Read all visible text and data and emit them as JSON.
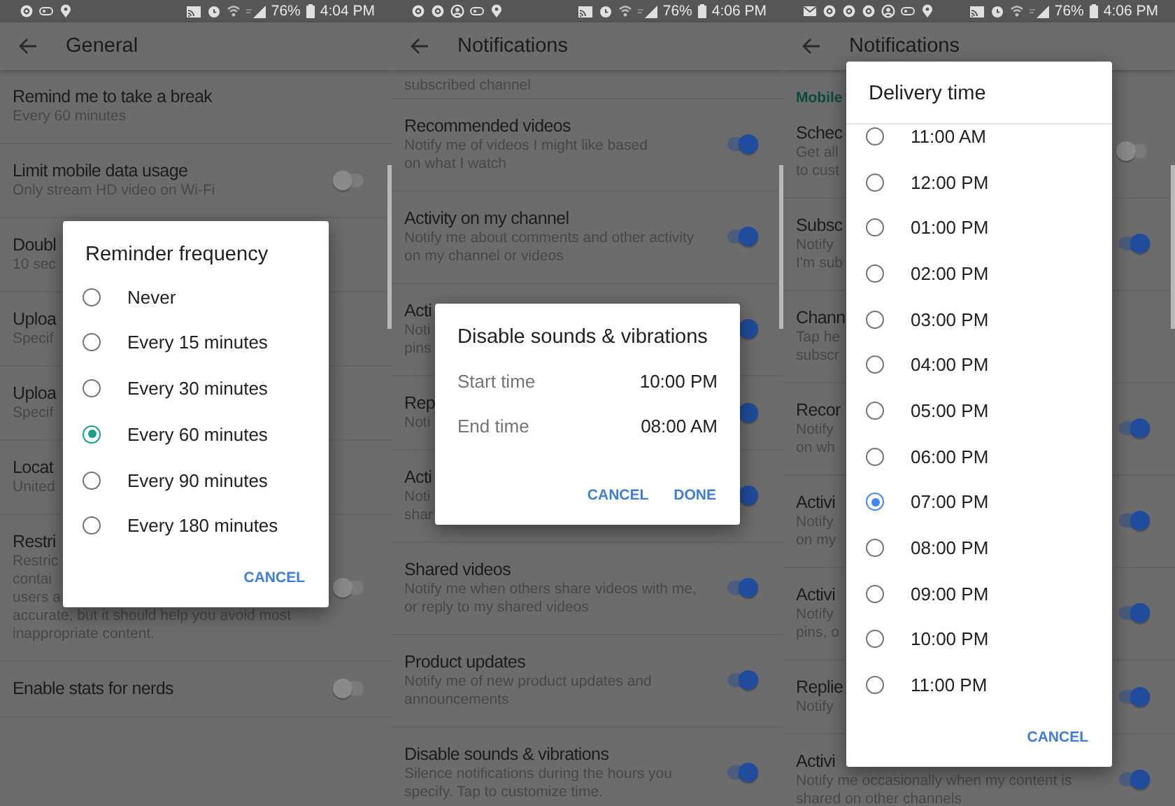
{
  "screens": [
    {
      "status_bar": {
        "icons": [
          {
            "kind": "gear"
          },
          {
            "kind": "badge"
          },
          {
            "kind": "pin"
          }
        ],
        "battery": "76%",
        "time": "4:04 PM"
      },
      "app_bar": {
        "title": "General"
      },
      "rows": [
        {
          "kind": "setting",
          "title": "Remind me to take a break",
          "description": "Every 60 minutes"
        },
        {
          "kind": "toggle",
          "title": "Limit mobile data usage",
          "description": "Only stream HD video on Wi-Fi",
          "on": false
        },
        {
          "kind": "setting",
          "title": "Doubl",
          "description": "10 sec"
        },
        {
          "kind": "setting",
          "title": "Uploa",
          "description": "Specif"
        },
        {
          "kind": "setting",
          "title": "Uploa",
          "description": "Specif"
        },
        {
          "kind": "setting",
          "title": "Locat",
          "description": "United"
        },
        {
          "kind": "toggle",
          "title": "Restri",
          "description": [
            "Restric",
            "contai",
            "users a",
            "accurate, but it should help you avoid most\ninappropriate content."
          ],
          "on": false
        },
        {
          "kind": "toggle",
          "title": "Enable stats for nerds",
          "on": false
        }
      ],
      "dialog": {
        "kind": "choices",
        "title": "Reminder frequency",
        "options": [
          {
            "label": "Never",
            "selected": false
          },
          {
            "label": "Every 15 minutes",
            "selected": false
          },
          {
            "label": "Every 30 minutes",
            "selected": false
          },
          {
            "label": "Every 60 minutes",
            "selected": true
          },
          {
            "label": "Every 90 minutes",
            "selected": false
          },
          {
            "label": "Every 180 minutes",
            "selected": false
          }
        ],
        "buttons": [
          "CANCEL"
        ]
      }
    },
    {
      "status_bar": {
        "icons": [
          {
            "kind": "gear"
          },
          {
            "kind": "gear"
          },
          {
            "kind": "person"
          },
          {
            "kind": "badge"
          },
          {
            "kind": "pin"
          }
        ],
        "battery": "76%",
        "time": "4:06 PM"
      },
      "app_bar": {
        "title": "Notifications"
      },
      "rows": [
        {
          "kind": "tail",
          "description": "subscribed channel"
        },
        {
          "kind": "toggle",
          "title": "Recommended videos",
          "description": "Notify me of videos I might like based\non what I watch",
          "on": true
        },
        {
          "kind": "toggle",
          "title": "Activity on my channel",
          "description": "Notify me about comments and other activity\non my channel or videos",
          "on": true
        },
        {
          "kind": "toggle",
          "title": "Acti",
          "description": "Noti\npins",
          "on": true
        },
        {
          "kind": "toggle",
          "title": "Rep",
          "description": "Noti",
          "on": true
        },
        {
          "kind": "toggle",
          "title": "Acti",
          "description": "Noti\nshar",
          "on": true
        },
        {
          "kind": "toggle",
          "title": "Shared videos",
          "description": "Notify me when others share videos with me,\nor reply to my shared videos",
          "on": true
        },
        {
          "kind": "toggle",
          "title": "Product updates",
          "description": "Notify me of new product updates and\nannouncements",
          "on": true
        },
        {
          "kind": "toggle",
          "title": "Disable sounds & vibrations",
          "description": "Silence notifications during the hours you\nspecify. Tap to customize time.",
          "on": true
        }
      ],
      "dialog": {
        "kind": "time_range",
        "title": "Disable sounds & vibrations",
        "rows": [
          {
            "label": "Start time",
            "value": "10:00 PM"
          },
          {
            "label": "End time",
            "value": "08:00 AM"
          }
        ],
        "buttons": [
          "CANCEL",
          "DONE"
        ]
      }
    },
    {
      "status_bar": {
        "icons": [
          {
            "kind": "mail"
          },
          {
            "kind": "gear"
          },
          {
            "kind": "gear"
          },
          {
            "kind": "gear"
          },
          {
            "kind": "person"
          },
          {
            "kind": "badge"
          },
          {
            "kind": "pin"
          }
        ],
        "battery": "76%",
        "time": "4:06 PM"
      },
      "app_bar": {
        "title": "Notifications"
      },
      "rows": [
        {
          "kind": "header",
          "title": "Mobile"
        },
        {
          "kind": "toggle",
          "title": "Schec",
          "description": "Get all\nto cust",
          "on": false
        },
        {
          "kind": "toggle",
          "title": "Subsc",
          "description": "Notify\nI'm sub",
          "on": true
        },
        {
          "kind": "setting",
          "title": "Chann",
          "description": "Tap he\nsubscr"
        },
        {
          "kind": "toggle",
          "title": "Recor",
          "description": "Notify\non wh",
          "on": true
        },
        {
          "kind": "toggle",
          "title": "Activi",
          "description": "Notify\non my",
          "on": true
        },
        {
          "kind": "toggle",
          "title": "Activi",
          "description": "Notify\npins, o",
          "on": true
        },
        {
          "kind": "toggle",
          "title": "Replie",
          "description": "Notify",
          "on": true
        },
        {
          "kind": "toggle",
          "title": "Activi",
          "description": "Notify me occasionally when my content is\nshared on other channels",
          "on": true
        }
      ],
      "dialog": {
        "kind": "scroll_choices",
        "title": "Delivery time",
        "options": [
          {
            "label": "11:00 AM",
            "selected": false
          },
          {
            "label": "12:00 PM",
            "selected": false
          },
          {
            "label": "01:00 PM",
            "selected": false
          },
          {
            "label": "02:00 PM",
            "selected": false
          },
          {
            "label": "03:00 PM",
            "selected": false
          },
          {
            "label": "04:00 PM",
            "selected": false
          },
          {
            "label": "05:00 PM",
            "selected": false
          },
          {
            "label": "06:00 PM",
            "selected": false
          },
          {
            "label": "07:00 PM",
            "selected": true
          },
          {
            "label": "08:00 PM",
            "selected": false
          },
          {
            "label": "09:00 PM",
            "selected": false
          },
          {
            "label": "10:00 PM",
            "selected": false
          },
          {
            "label": "11:00 PM",
            "selected": false
          }
        ],
        "buttons": [
          "CANCEL"
        ]
      }
    }
  ]
}
